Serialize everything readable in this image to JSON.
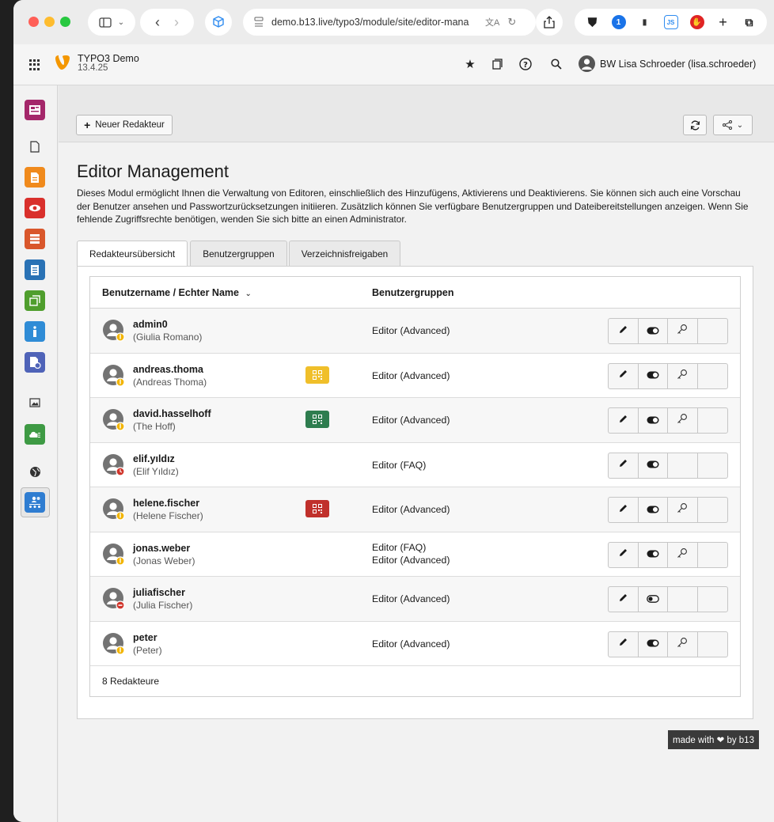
{
  "browser": {
    "url": "demo.b13.live/typo3/module/site/editor-mana"
  },
  "topbar": {
    "brand_name": "TYPO3 Demo",
    "brand_version": "13.4.25",
    "user_name": "BW Lisa Schroeder (lisa.schroeder)"
  },
  "docheader": {
    "new_button_label": "Neuer Redakteur"
  },
  "page": {
    "title": "Editor Management",
    "intro": "Dieses Modul ermöglicht Ihnen die Verwaltung von Editoren, einschließlich des Hinzufügens, Aktivierens und Deaktivierens. Sie können sich auch eine Vorschau der Benutzer ansehen und Passwortzurücksetzungen initiieren. Zusätzlich können Sie verfügbare Benutzergruppen und Dateibereitstellungen anzeigen. Wenn Sie fehlende Zugriffsrechte benötigen, wenden Sie sich bitte an einen Administrator."
  },
  "tabs": [
    {
      "label": "Redakteursübersicht",
      "active": true
    },
    {
      "label": "Benutzergruppen",
      "active": false
    },
    {
      "label": "Verzeichnisfreigaben",
      "active": false
    }
  ],
  "table": {
    "col_user": "Benutzername / Echter Name",
    "col_groups": "Benutzergruppen",
    "footer": "8 Redakteure",
    "rows": [
      {
        "username": "admin0",
        "realname": "(Giulia Romano)",
        "groups": [
          "Editor (Advanced)"
        ],
        "badge": "key",
        "qr": null,
        "active": true,
        "reset": true
      },
      {
        "username": "andreas.thoma",
        "realname": "(Andreas Thoma)",
        "groups": [
          "Editor (Advanced)"
        ],
        "badge": "key",
        "qr": "#f0bf2a",
        "active": true,
        "reset": true
      },
      {
        "username": "david.hasselhoff",
        "realname": "(The Hoff)",
        "groups": [
          "Editor (Advanced)"
        ],
        "badge": "key",
        "qr": "#2e7d4f",
        "active": true,
        "reset": true
      },
      {
        "username": "elif.yıldız",
        "realname": "(Elif Yıldız)",
        "groups": [
          "Editor (FAQ)"
        ],
        "badge": "clock",
        "qr": null,
        "active": true,
        "reset": false
      },
      {
        "username": "helene.fischer",
        "realname": "(Helene Fischer)",
        "groups": [
          "Editor (Advanced)"
        ],
        "badge": "key",
        "qr": "#c0302b",
        "active": true,
        "reset": true
      },
      {
        "username": "jonas.weber",
        "realname": "(Jonas Weber)",
        "groups": [
          "Editor (FAQ)",
          "Editor (Advanced)"
        ],
        "badge": "key",
        "qr": null,
        "active": true,
        "reset": true
      },
      {
        "username": "juliafischer",
        "realname": "(Julia Fischer)",
        "groups": [
          "Editor (Advanced)"
        ],
        "badge": "disabled",
        "qr": null,
        "active": false,
        "reset": false
      },
      {
        "username": "peter",
        "realname": "(Peter)",
        "groups": [
          "Editor (Advanced)"
        ],
        "badge": "key",
        "qr": null,
        "active": true,
        "reset": true
      }
    ]
  },
  "footer_badge": "made with ❤ by b13",
  "colors": {
    "typo3_orange": "#f49700",
    "qr_yellow": "#f0bf2a",
    "qr_green": "#2e7d4f",
    "qr_red": "#c0302b"
  }
}
